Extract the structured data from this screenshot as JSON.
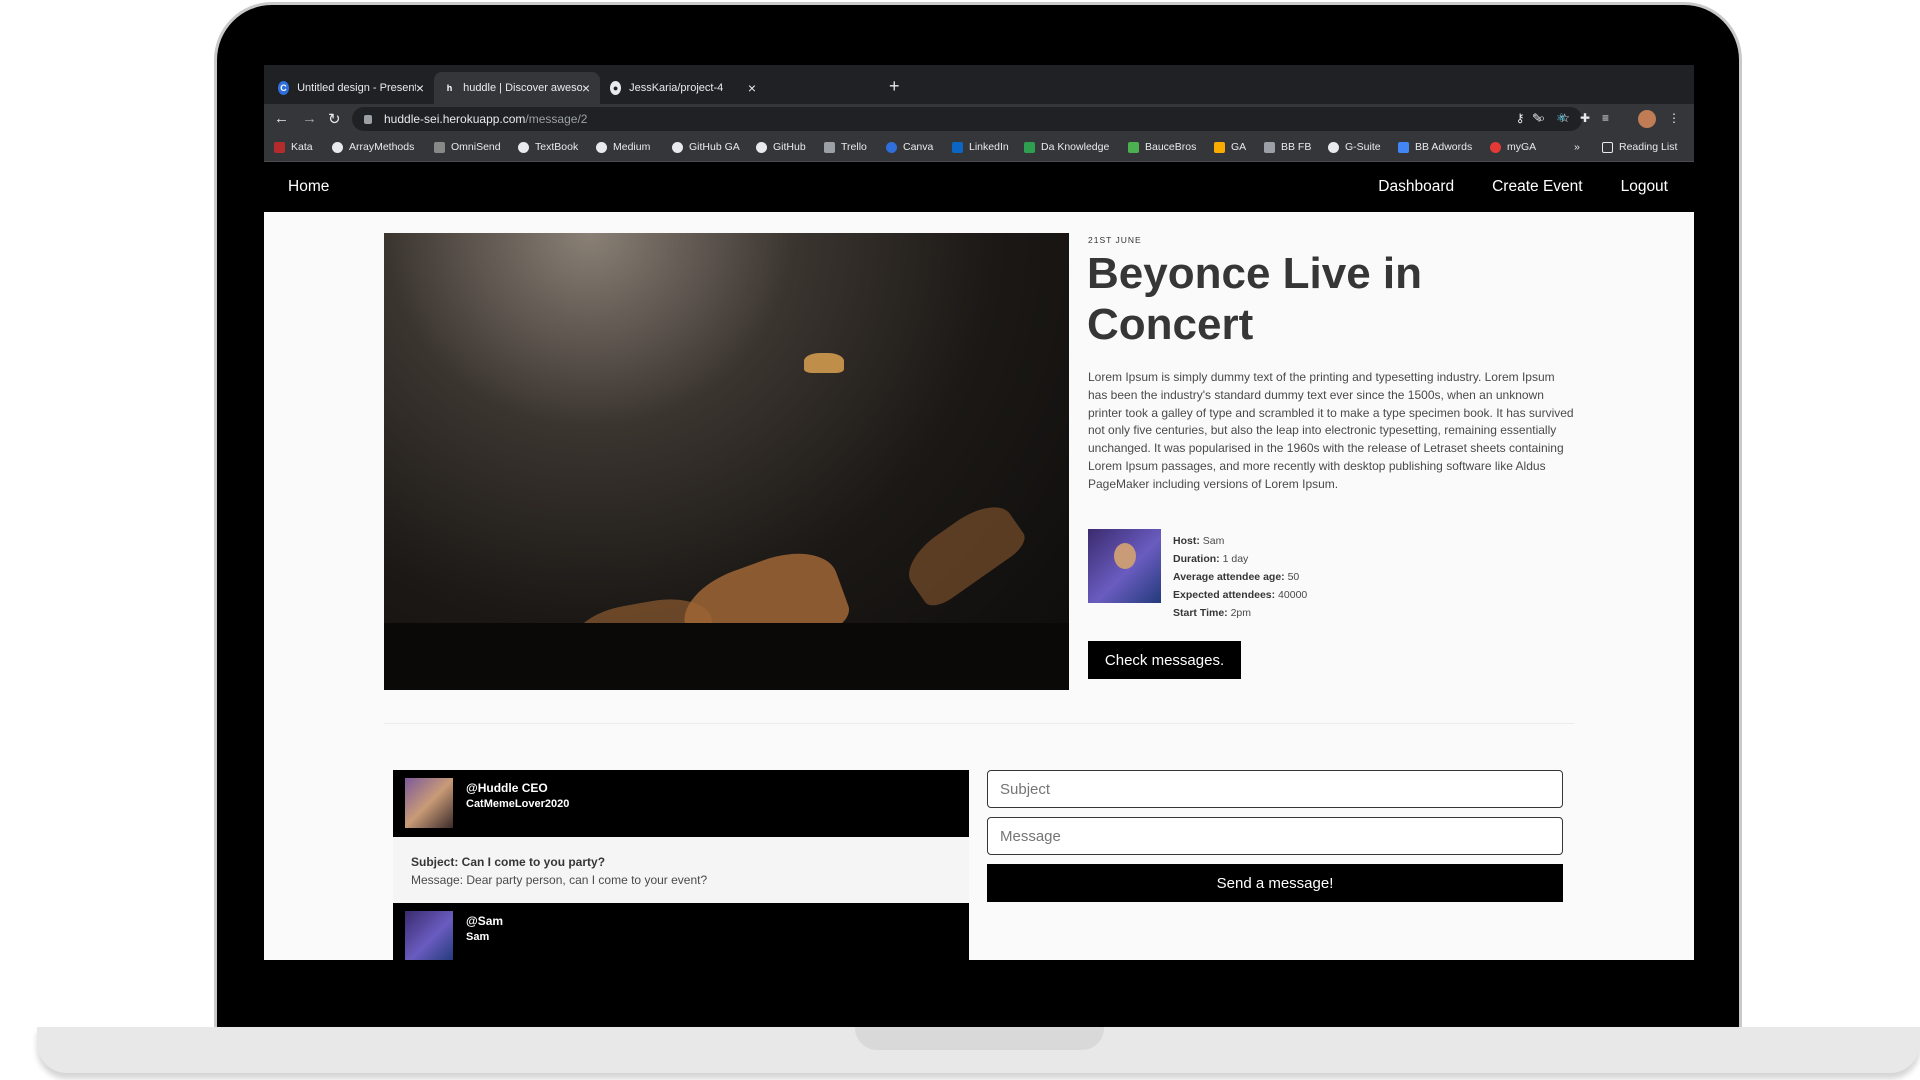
{
  "browser": {
    "tabs": [
      {
        "title": "Untitled design - Presentation",
        "favicon": "canva-icon"
      },
      {
        "title": "huddle | Discover awesome ev",
        "favicon": "huddle-icon"
      },
      {
        "title": "JessKaria/project-4",
        "favicon": "github-icon"
      }
    ],
    "new_tab": "+",
    "url_domain": "huddle-sei.herokuapp.com",
    "url_path": "/message/2",
    "bookmarks": [
      "Kata",
      "ArrayMethods",
      "OmniSend",
      "TextBook",
      "Medium",
      "GitHub GA",
      "GitHub",
      "Trello",
      "Canva",
      "LinkedIn",
      "Da Knowledge",
      "BauceBros",
      "GA",
      "BB FB",
      "G-Suite",
      "BB Adwords",
      "myGA"
    ],
    "overflow": "»",
    "reading_list": "Reading List"
  },
  "nav": {
    "home": "Home",
    "dashboard": "Dashboard",
    "create_event": "Create Event",
    "logout": "Logout"
  },
  "event": {
    "date": "21ST JUNE",
    "title": "Beyonce Live in Concert",
    "description": "Lorem Ipsum is simply dummy text of the printing and typesetting industry. Lorem Ipsum has been the industry's standard dummy text ever since the 1500s, when an unknown printer took a galley of type and scrambled it to make a type specimen book. It has survived not only five centuries, but also the leap into electronic typesetting, remaining essentially unchanged. It was popularised in the 1960s with the release of Letraset sheets containing Lorem Ipsum passages, and more recently with desktop publishing software like Aldus PageMaker including versions of Lorem Ipsum.",
    "host_label": "Host:",
    "host": "Sam",
    "duration_label": "Duration:",
    "duration": "1 day",
    "age_label": "Average attendee age:",
    "age": "50",
    "attendees_label": "Expected attendees:",
    "attendees": "40000",
    "start_label": "Start Time:",
    "start": "2pm",
    "check_messages": "Check messages."
  },
  "messages": [
    {
      "handle": "@Huddle CEO",
      "name": "CatMemeLover2020",
      "subject": "Subject: Can I come to you party?",
      "message": "Message: Dear party person, can I come to your event?"
    },
    {
      "handle": "@Sam",
      "name": "Sam"
    }
  ],
  "form": {
    "subject_placeholder": "Subject",
    "message_placeholder": "Message",
    "send": "Send a message!"
  }
}
